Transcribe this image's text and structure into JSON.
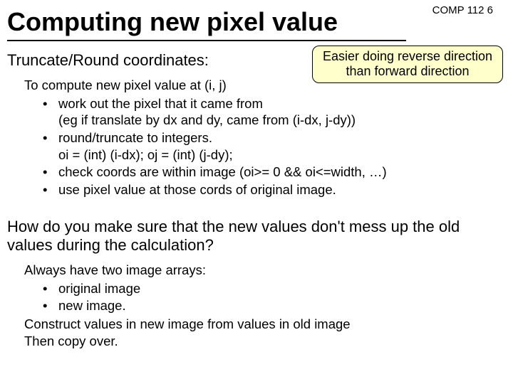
{
  "course_code": "COMP 112  6",
  "title": "Computing new pixel value",
  "callout": {
    "line1": "Easier doing reverse direction",
    "line2": "than forward direction"
  },
  "section1_heading": "Truncate/Round coordinates:",
  "section1_lead": "To compute new pixel value at  (i, j)",
  "section1_bullets": [
    "work out the pixel that it came from\n(eg  if translate by dx and dy,  came from  (i-dx, j-dy))",
    "round/truncate  to integers.\noi = (int) (i-dx);   oj = (int) (j-dy);",
    "check  coords are within image  (oi>= 0 && oi<=width, …)",
    "use pixel value at those cords of original image."
  ],
  "question": "How do you make sure that the new values don't mess up the old values during the calculation?",
  "section2_lead": "Always have two image arrays:",
  "section2_bullets": [
    "original image",
    "new image."
  ],
  "section2_tail1": "Construct values in new image from values in old image",
  "section2_tail2": "Then copy over."
}
